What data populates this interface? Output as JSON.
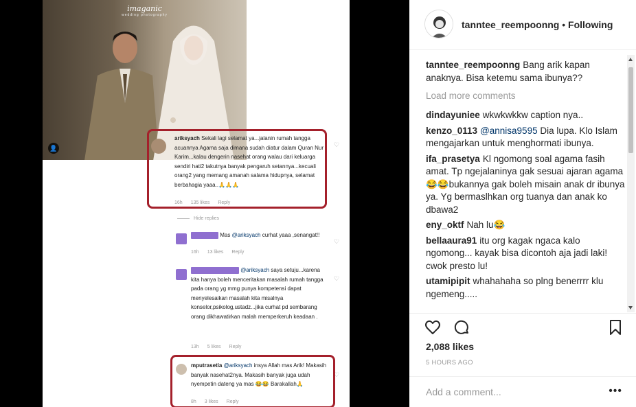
{
  "post_image": {
    "brand": "imaganic",
    "brand_sub": "wedding photography",
    "comments": [
      {
        "user": "ariksyach",
        "text": "Sekali lagi selamat ya...jalanin rumah tangga acuannya Agama saja dimana sudah diatur dalam Quran Nur Karim...kalau dengerin nasehat orang walau dari keluarga sendiri hati2 takutnya banyak pengaruh setannya...kecuali orang2 yang memang amanah salama hidupnya, selamat berbahagia yaaa..🙏🙏🙏",
        "time": "16h",
        "likes": "135 likes",
        "reply": "Reply"
      },
      {
        "hide": "Hide replies"
      },
      {
        "mention": "@ariksyach",
        "text": "curhat yaaa ,senangat!!",
        "prefix": "Mas",
        "time": "16h",
        "likes": "13 likes",
        "reply": "Reply"
      },
      {
        "mention": "@ariksyach",
        "text": "saya setuju...karena kita hanya boleh menceritakan masalah rumah tangga pada orang yg mmg punya kompetensi dapat menyelesaikan masalah kita misalnya konselor,psikolog,ustadz...jika curhat pd sembarang orang dikhawatirkan malah memperkeruh keadaan .",
        "time": "13h",
        "likes": "5 likes",
        "reply": "Reply"
      },
      {
        "user": "mputrasetia",
        "mention": "@ariksyach",
        "text": "insya Allah mas Arik! Makasih banyak nasehat2nya. Makasih banyak juga udah nyempetin dateng ya mas 😂😂 Barakallah🙏",
        "time": "8h",
        "likes": "3 likes",
        "reply": "Reply"
      }
    ]
  },
  "header": {
    "username": "tanntee_reempoonng",
    "separator": "•",
    "follow_state": "Following"
  },
  "comments": [
    {
      "user": "tanntee_reempoonng",
      "text": "Bang arik kapan anaknya. Bisa ketemu sama ibunya??"
    },
    {
      "load_more": "Load more comments"
    },
    {
      "user": "dindayuniee",
      "text": "wkwkwkkw caption nya.."
    },
    {
      "user": "kenzo_0113",
      "mention": "@annisa9595",
      "text": "Dia lupa. Klo Islam mengajarkan untuk menghormati ibunya."
    },
    {
      "user": "ifa_prasetya",
      "text": "Kl ngomong soal agama fasih amat. Tp ngejalaninya gak sesuai ajaran agama😂😂bukannya gak boleh misain anak dr ibunya ya. Yg bermaslhkan org tuanya dan anak ko dbawa2"
    },
    {
      "user": "eny_oktf",
      "text": "Nah lu😂"
    },
    {
      "user": "bellaaura91",
      "text": "itu org kagak ngaca kalo ngomong... kayak bisa dicontoh aja jadi laki! cwok presto lu!"
    },
    {
      "user": "utamipipit",
      "text": "whahahaha so plng benerrrr klu ngemeng....."
    }
  ],
  "likes": "2,088 likes",
  "time_ago": "5 HOURS AGO",
  "add_comment": {
    "placeholder": "Add a comment..."
  },
  "more": "•••",
  "icons": [
    "heart-icon",
    "comment-icon",
    "bookmark-icon"
  ]
}
